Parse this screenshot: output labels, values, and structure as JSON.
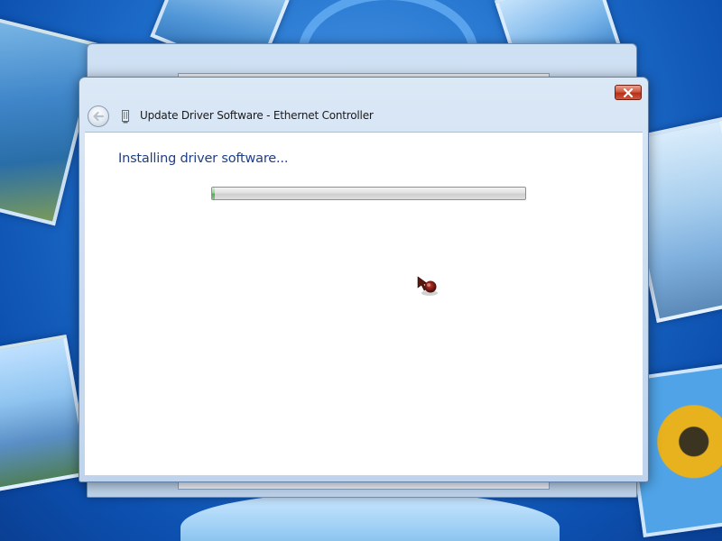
{
  "dialog": {
    "title": "Update Driver Software - Ethernet Controller",
    "heading": "Installing driver software...",
    "progress_fraction": 0.01
  },
  "icons": {
    "back": "back-arrow-icon",
    "close": "close-icon",
    "device": "network-device-icon",
    "cursor": "busy-cursor-icon"
  },
  "colors": {
    "heading_text": "#1f3f86",
    "close_button": "#c8402a",
    "progress_fill": "#49b649"
  }
}
